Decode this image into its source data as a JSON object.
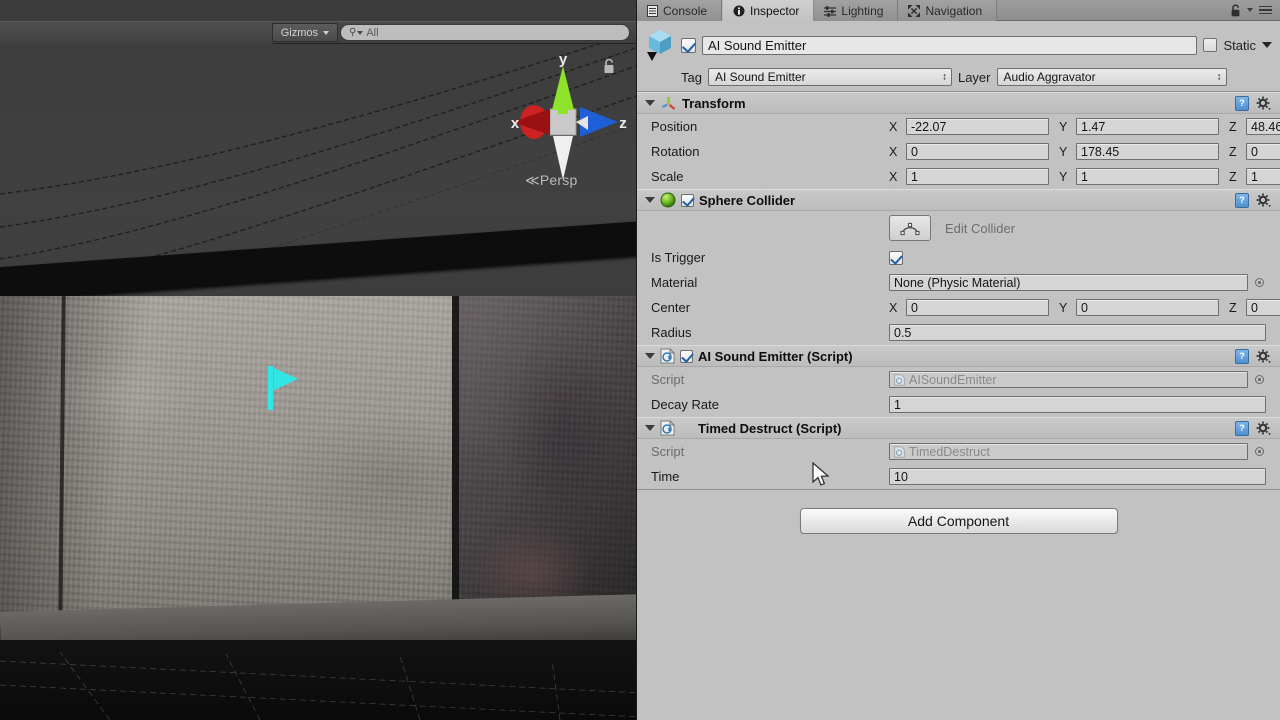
{
  "scene_view": {
    "toolbar": {
      "gizmos_label": "Gizmos",
      "gizmos_icon": "chevron-down-icon",
      "search_value": "All",
      "search_icon": "search-icon"
    },
    "orientation_gizmo": {
      "x_label": "x",
      "y_label": "y",
      "z_label": "z",
      "projection_label": "Persp",
      "projection_arrow": "≪",
      "x_color": "#cc2222",
      "y_color": "#8ee32a",
      "z_color": "#1e5fd8",
      "center_color": "#cfcfcf",
      "neg_axis_color": "#e8e8e8"
    },
    "lock_icon": "padlock-icon",
    "selection_gizmo": {
      "name": "flag-gizmo",
      "color": "#33e6e6"
    },
    "colors": {
      "sky": "#3e3e3e",
      "wall": "#9c9893",
      "floor": "#0c0c0d",
      "trim": "#0d0d0e"
    }
  },
  "inspector": {
    "tabs": [
      {
        "label": "Console",
        "icon": "console-icon",
        "active": false
      },
      {
        "label": "Inspector",
        "icon": "info-icon",
        "active": true
      },
      {
        "label": "Lighting",
        "icon": "lighting-icon",
        "active": false
      },
      {
        "label": "Navigation",
        "icon": "navigation-icon",
        "active": false
      }
    ],
    "tabbar_right": {
      "lock_icon": "padlock-icon",
      "menu_icon": "hamburger-menu-icon"
    },
    "object_header": {
      "prefab_icon": "cube-prefab-icon",
      "enabled": true,
      "name_value": "AI Sound Emitter",
      "static_label": "Static",
      "static_checked": false,
      "static_dropdown_icon": "chevron-down-icon",
      "tag_label": "Tag",
      "tag_value": "AI Sound Emitter",
      "layer_label": "Layer",
      "layer_value": "Audio Aggravator"
    },
    "components": [
      {
        "id": "transform",
        "title": "Transform",
        "icon": "transform-axes-icon",
        "has_checkbox": false,
        "help_icon": "help-book-icon",
        "gear_icon": "gear-icon",
        "rows": [
          {
            "type": "vector3",
            "label": "Position",
            "axes": [
              "X",
              "Y",
              "Z"
            ],
            "values": [
              "-22.07",
              "1.47",
              "48.46"
            ]
          },
          {
            "type": "vector3",
            "label": "Rotation",
            "axes": [
              "X",
              "Y",
              "Z"
            ],
            "values": [
              "0",
              "178.45",
              "0"
            ]
          },
          {
            "type": "vector3",
            "label": "Scale",
            "axes": [
              "X",
              "Y",
              "Z"
            ],
            "values": [
              "1",
              "1",
              "1"
            ]
          }
        ]
      },
      {
        "id": "sphere-collider",
        "title": "Sphere Collider",
        "icon": "sphere-collider-icon",
        "has_checkbox": true,
        "checked": true,
        "help_icon": "help-book-icon",
        "gear_icon": "gear-icon",
        "edit_collider": {
          "label": "Edit Collider",
          "icon": "edit-collider-icon"
        },
        "rows": [
          {
            "type": "checkbox",
            "label": "Is Trigger",
            "checked": true
          },
          {
            "type": "object",
            "label": "Material",
            "value": "None (Physic Material)",
            "picker_icon": "object-picker-icon"
          },
          {
            "type": "vector3",
            "label": "Center",
            "axes": [
              "X",
              "Y",
              "Z"
            ],
            "values": [
              "0",
              "0",
              "0"
            ]
          },
          {
            "type": "text",
            "label": "Radius",
            "value": "0.5"
          }
        ]
      },
      {
        "id": "ai-sound-emitter-script",
        "title": "AI Sound Emitter (Script)",
        "icon": "csharp-script-icon",
        "has_checkbox": true,
        "checked": true,
        "help_icon": "help-book-icon",
        "gear_icon": "gear-icon",
        "rows": [
          {
            "type": "script",
            "label": "Script",
            "value": "AISoundEmitter",
            "picker_icon": "object-picker-icon"
          },
          {
            "type": "text",
            "label": "Decay Rate",
            "value": "1"
          }
        ]
      },
      {
        "id": "timed-destruct-script",
        "title": "Timed Destruct (Script)",
        "icon": "csharp-script-icon",
        "has_checkbox": false,
        "help_icon": "help-book-icon",
        "gear_icon": "gear-icon",
        "rows": [
          {
            "type": "script",
            "label": "Script",
            "value": "TimedDestruct",
            "picker_icon": "object-picker-icon"
          },
          {
            "type": "text",
            "label": "Time",
            "value": "10"
          }
        ]
      }
    ],
    "add_component_label": "Add Component"
  }
}
